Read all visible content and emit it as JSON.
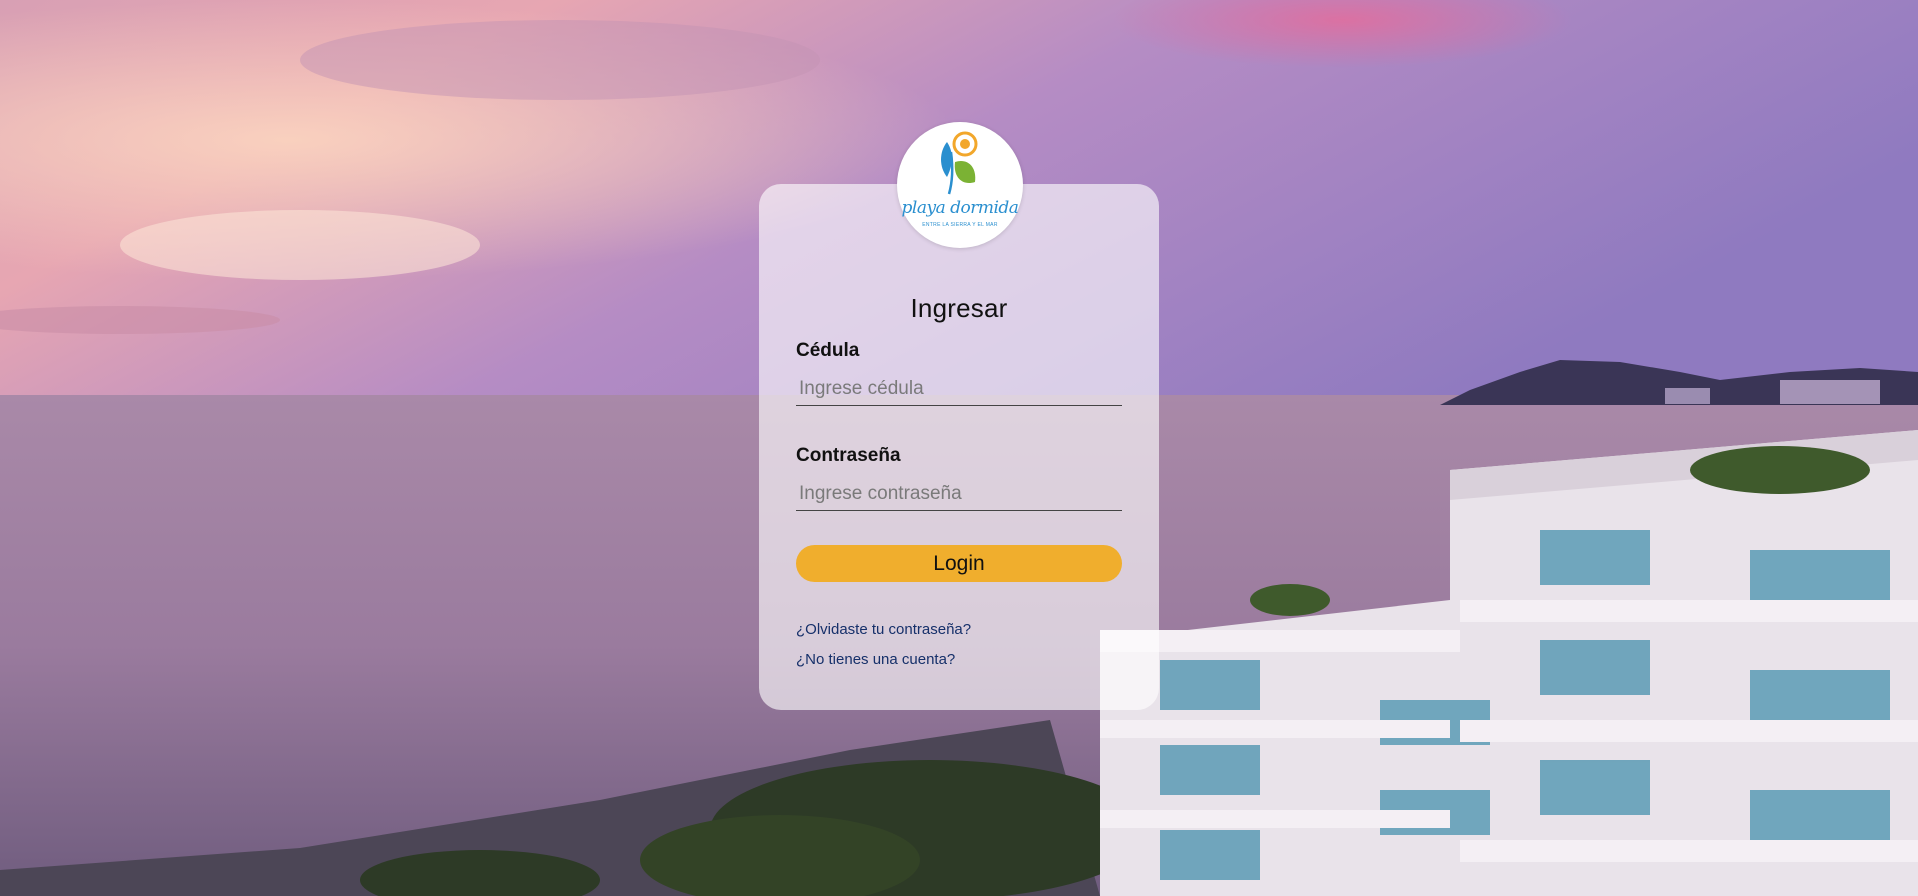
{
  "login": {
    "title": "Ingresar",
    "cedula_label": "Cédula",
    "cedula_placeholder": "Ingrese cédula",
    "cedula_value": "",
    "password_label": "Contraseña",
    "password_placeholder": "Ingrese contraseña",
    "password_value": "",
    "login_button": "Login",
    "forgot_password_link": "¿Olvidaste tu contraseña?",
    "no_account_link": "¿No tienes una cuenta?"
  },
  "logo": {
    "name": "playa dormida",
    "tagline": "ENTRE LA SIERRA Y EL MAR",
    "icon": "palm-sun-logo-icon"
  },
  "colors": {
    "accent": "#f0ae2d",
    "link": "#16306a",
    "logo_blue": "#2a8fcf",
    "logo_green": "#7bb234",
    "logo_orange": "#f2a72b"
  }
}
